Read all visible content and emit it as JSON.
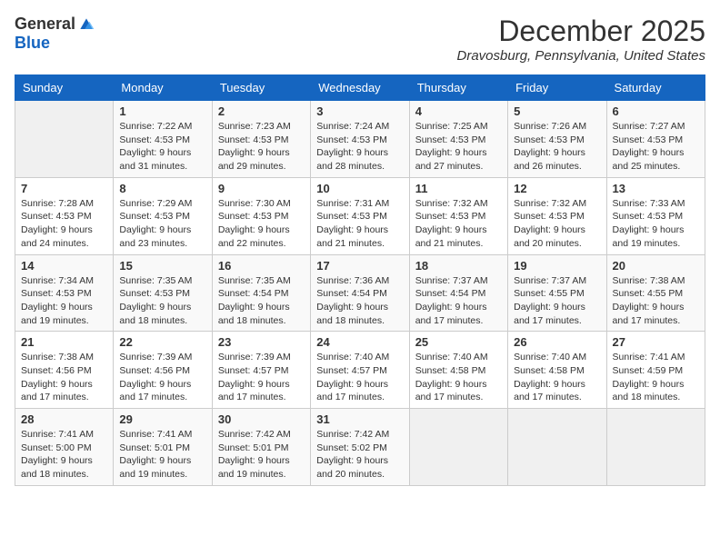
{
  "logo": {
    "general": "General",
    "blue": "Blue"
  },
  "title": "December 2025",
  "location": "Dravosburg, Pennsylvania, United States",
  "days_of_week": [
    "Sunday",
    "Monday",
    "Tuesday",
    "Wednesday",
    "Thursday",
    "Friday",
    "Saturday"
  ],
  "weeks": [
    [
      {
        "day": "",
        "info": ""
      },
      {
        "day": "1",
        "info": "Sunrise: 7:22 AM\nSunset: 4:53 PM\nDaylight: 9 hours\nand 31 minutes."
      },
      {
        "day": "2",
        "info": "Sunrise: 7:23 AM\nSunset: 4:53 PM\nDaylight: 9 hours\nand 29 minutes."
      },
      {
        "day": "3",
        "info": "Sunrise: 7:24 AM\nSunset: 4:53 PM\nDaylight: 9 hours\nand 28 minutes."
      },
      {
        "day": "4",
        "info": "Sunrise: 7:25 AM\nSunset: 4:53 PM\nDaylight: 9 hours\nand 27 minutes."
      },
      {
        "day": "5",
        "info": "Sunrise: 7:26 AM\nSunset: 4:53 PM\nDaylight: 9 hours\nand 26 minutes."
      },
      {
        "day": "6",
        "info": "Sunrise: 7:27 AM\nSunset: 4:53 PM\nDaylight: 9 hours\nand 25 minutes."
      }
    ],
    [
      {
        "day": "7",
        "info": "Sunrise: 7:28 AM\nSunset: 4:53 PM\nDaylight: 9 hours\nand 24 minutes."
      },
      {
        "day": "8",
        "info": "Sunrise: 7:29 AM\nSunset: 4:53 PM\nDaylight: 9 hours\nand 23 minutes."
      },
      {
        "day": "9",
        "info": "Sunrise: 7:30 AM\nSunset: 4:53 PM\nDaylight: 9 hours\nand 22 minutes."
      },
      {
        "day": "10",
        "info": "Sunrise: 7:31 AM\nSunset: 4:53 PM\nDaylight: 9 hours\nand 21 minutes."
      },
      {
        "day": "11",
        "info": "Sunrise: 7:32 AM\nSunset: 4:53 PM\nDaylight: 9 hours\nand 21 minutes."
      },
      {
        "day": "12",
        "info": "Sunrise: 7:32 AM\nSunset: 4:53 PM\nDaylight: 9 hours\nand 20 minutes."
      },
      {
        "day": "13",
        "info": "Sunrise: 7:33 AM\nSunset: 4:53 PM\nDaylight: 9 hours\nand 19 minutes."
      }
    ],
    [
      {
        "day": "14",
        "info": "Sunrise: 7:34 AM\nSunset: 4:53 PM\nDaylight: 9 hours\nand 19 minutes."
      },
      {
        "day": "15",
        "info": "Sunrise: 7:35 AM\nSunset: 4:53 PM\nDaylight: 9 hours\nand 18 minutes."
      },
      {
        "day": "16",
        "info": "Sunrise: 7:35 AM\nSunset: 4:54 PM\nDaylight: 9 hours\nand 18 minutes."
      },
      {
        "day": "17",
        "info": "Sunrise: 7:36 AM\nSunset: 4:54 PM\nDaylight: 9 hours\nand 18 minutes."
      },
      {
        "day": "18",
        "info": "Sunrise: 7:37 AM\nSunset: 4:54 PM\nDaylight: 9 hours\nand 17 minutes."
      },
      {
        "day": "19",
        "info": "Sunrise: 7:37 AM\nSunset: 4:55 PM\nDaylight: 9 hours\nand 17 minutes."
      },
      {
        "day": "20",
        "info": "Sunrise: 7:38 AM\nSunset: 4:55 PM\nDaylight: 9 hours\nand 17 minutes."
      }
    ],
    [
      {
        "day": "21",
        "info": "Sunrise: 7:38 AM\nSunset: 4:56 PM\nDaylight: 9 hours\nand 17 minutes."
      },
      {
        "day": "22",
        "info": "Sunrise: 7:39 AM\nSunset: 4:56 PM\nDaylight: 9 hours\nand 17 minutes."
      },
      {
        "day": "23",
        "info": "Sunrise: 7:39 AM\nSunset: 4:57 PM\nDaylight: 9 hours\nand 17 minutes."
      },
      {
        "day": "24",
        "info": "Sunrise: 7:40 AM\nSunset: 4:57 PM\nDaylight: 9 hours\nand 17 minutes."
      },
      {
        "day": "25",
        "info": "Sunrise: 7:40 AM\nSunset: 4:58 PM\nDaylight: 9 hours\nand 17 minutes."
      },
      {
        "day": "26",
        "info": "Sunrise: 7:40 AM\nSunset: 4:58 PM\nDaylight: 9 hours\nand 17 minutes."
      },
      {
        "day": "27",
        "info": "Sunrise: 7:41 AM\nSunset: 4:59 PM\nDaylight: 9 hours\nand 18 minutes."
      }
    ],
    [
      {
        "day": "28",
        "info": "Sunrise: 7:41 AM\nSunset: 5:00 PM\nDaylight: 9 hours\nand 18 minutes."
      },
      {
        "day": "29",
        "info": "Sunrise: 7:41 AM\nSunset: 5:01 PM\nDaylight: 9 hours\nand 19 minutes."
      },
      {
        "day": "30",
        "info": "Sunrise: 7:42 AM\nSunset: 5:01 PM\nDaylight: 9 hours\nand 19 minutes."
      },
      {
        "day": "31",
        "info": "Sunrise: 7:42 AM\nSunset: 5:02 PM\nDaylight: 9 hours\nand 20 minutes."
      },
      {
        "day": "",
        "info": ""
      },
      {
        "day": "",
        "info": ""
      },
      {
        "day": "",
        "info": ""
      }
    ]
  ]
}
